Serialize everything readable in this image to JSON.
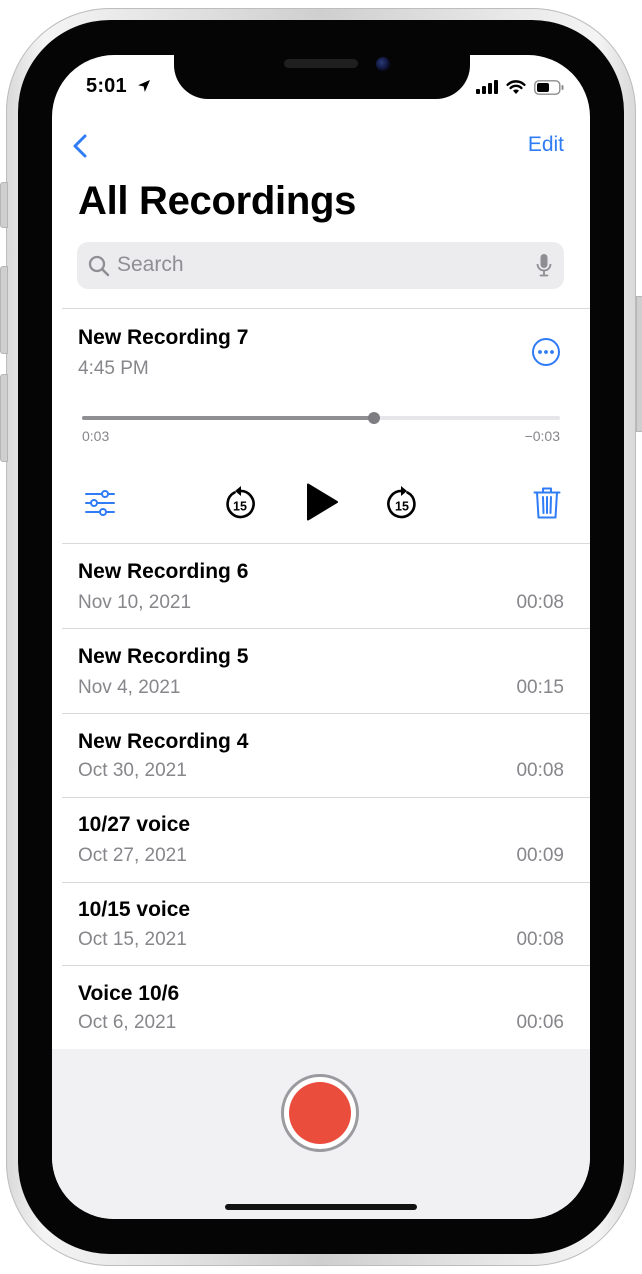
{
  "status_bar": {
    "time": "5:01"
  },
  "nav": {
    "edit_label": "Edit"
  },
  "page": {
    "title": "All Recordings"
  },
  "search": {
    "placeholder": "Search",
    "value": ""
  },
  "selected_recording": {
    "name": "New Recording 7",
    "time": "4:45 PM",
    "elapsed": "0:03",
    "remaining": "−0:03",
    "progress": 0.61,
    "skip_back_seconds": "15",
    "skip_forward_seconds": "15"
  },
  "recordings": [
    {
      "name": "New Recording 6",
      "date": "Nov 10, 2021",
      "duration": "00:08"
    },
    {
      "name": "New Recording 5",
      "date": "Nov 4, 2021",
      "duration": "00:15"
    },
    {
      "name": "New Recording 4",
      "date": "Oct 30, 2021",
      "duration": "00:08"
    },
    {
      "name": "10/27 voice",
      "date": "Oct 27, 2021",
      "duration": "00:09"
    },
    {
      "name": "10/15 voice",
      "date": "Oct 15, 2021",
      "duration": "00:08"
    },
    {
      "name": "Voice 10/6",
      "date": "Oct 6, 2021",
      "duration": "00:06"
    }
  ],
  "icons": {
    "back": "chevron-left-icon",
    "search": "search-icon",
    "mic": "mic-icon",
    "more": "ellipsis-circle-icon",
    "options": "sliders-icon",
    "skip_back": "skip-back-15-icon",
    "play": "play-icon",
    "skip_forward": "skip-forward-15-icon",
    "delete": "trash-icon",
    "record": "record-button"
  },
  "colors": {
    "accent": "#2f7cf6",
    "record": "#eb4d3d",
    "secondary_text": "#86868b"
  }
}
